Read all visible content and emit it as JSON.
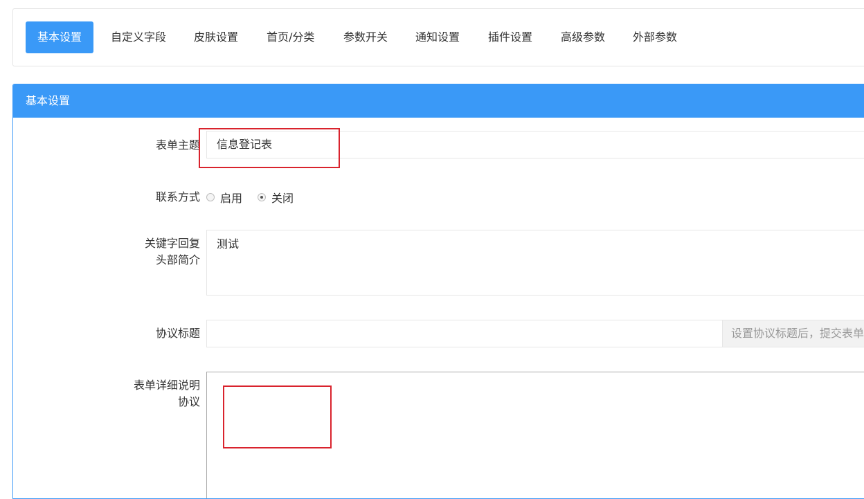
{
  "tabs": [
    {
      "label": "基本设置",
      "active": true
    },
    {
      "label": "自定义字段"
    },
    {
      "label": "皮肤设置"
    },
    {
      "label": "首页/分类"
    },
    {
      "label": "参数开关"
    },
    {
      "label": "通知设置"
    },
    {
      "label": "插件设置"
    },
    {
      "label": "高级参数"
    },
    {
      "label": "外部参数"
    }
  ],
  "panel": {
    "title": "基本设置"
  },
  "form": {
    "subject": {
      "label": "表单主题",
      "value": "信息登记表"
    },
    "contact": {
      "label": "联系方式",
      "options": [
        {
          "label": "启用",
          "checked": false
        },
        {
          "label": "关闭",
          "checked": true
        }
      ]
    },
    "keyword_reply": {
      "label_line1": "关键字回复",
      "label_line2": "头部简介",
      "value": "测试"
    },
    "agreement_title": {
      "label": "协议标题",
      "value": "",
      "addon": "设置协议标题后，提交表单"
    },
    "detail": {
      "label_line1": "表单详细说明",
      "label_line2": "协议"
    }
  },
  "colors": {
    "accent": "#3a99f7",
    "highlight": "#d9232d"
  }
}
